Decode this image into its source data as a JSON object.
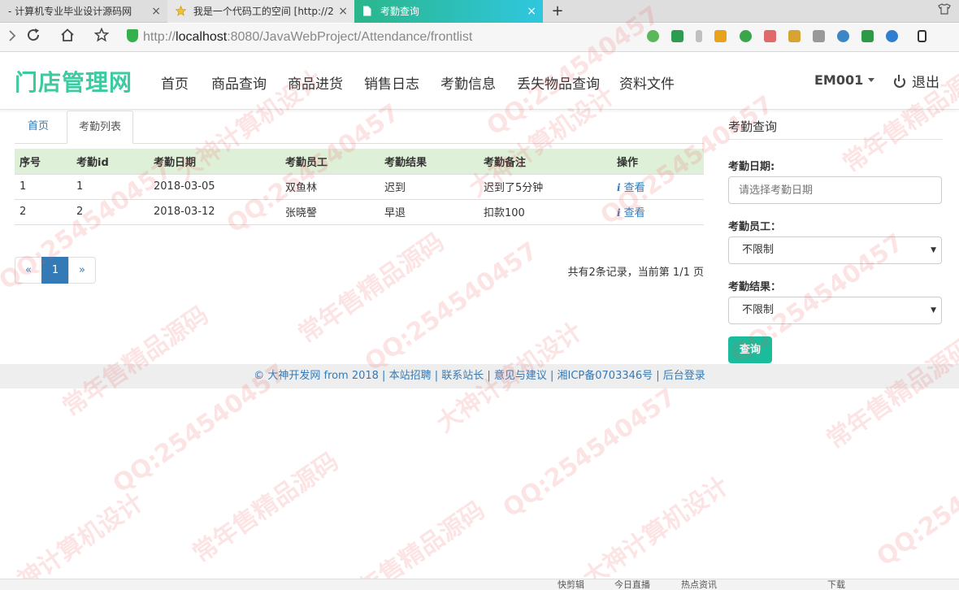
{
  "browser": {
    "tabs": [
      {
        "title": "- 计算机专业毕业设计源码网"
      },
      {
        "title": "我是一个代码工的空间 [http://2"
      },
      {
        "title": "考勤查询"
      }
    ],
    "close_glyph": "×",
    "new_tab_glyph": "+",
    "url_prefix": "http://",
    "url_host": "localhost",
    "url_path": ":8080/JavaWebProject/Attendance/frontlist"
  },
  "app": {
    "brand": "门店管理网",
    "nav": [
      "首页",
      "商品查询",
      "商品进货",
      "销售日志",
      "考勤信息",
      "丢失物品查询",
      "资料文件"
    ],
    "user": "EM001",
    "logout": "退出",
    "brand_color": "#3ccba0"
  },
  "content": {
    "tabs": [
      "首页",
      "考勤列表"
    ],
    "table": {
      "headers": [
        "序号",
        "考勤id",
        "考勤日期",
        "考勤员工",
        "考勤结果",
        "考勤备注",
        "操作"
      ],
      "rows": [
        [
          "1",
          "1",
          "2018-03-05",
          "双鱼林",
          "迟到",
          "迟到了5分钟",
          "查看"
        ],
        [
          "2",
          "2",
          "2018-03-12",
          "张晓謦",
          "早退",
          "扣款100",
          "查看"
        ]
      ]
    },
    "pagination": {
      "prev": "«",
      "pages": [
        "1"
      ],
      "next": "»",
      "info": "共有2条记录，当前第 1/1 页"
    }
  },
  "sidebar": {
    "title": "考勤查询",
    "date_label": "考勤日期:",
    "date_placeholder": "请选择考勤日期",
    "employee_label": "考勤员工：",
    "employee_value": "不限制",
    "result_label": "考勤结果：",
    "result_value": "不限制",
    "submit": "查询"
  },
  "footer": {
    "text": "© 大神开发网 from 2018 | 本站招聘 | 联系站长 | 意见与建议 | 湘ICP备0703346号 | 后台登录"
  },
  "statusbar": {
    "items": [
      "快剪辑",
      "今日直播",
      "热点资讯",
      "下载"
    ]
  },
  "watermark": {
    "lines": [
      "QQ:254540457",
      "大神计算机设计",
      "常年售精品源码"
    ]
  }
}
